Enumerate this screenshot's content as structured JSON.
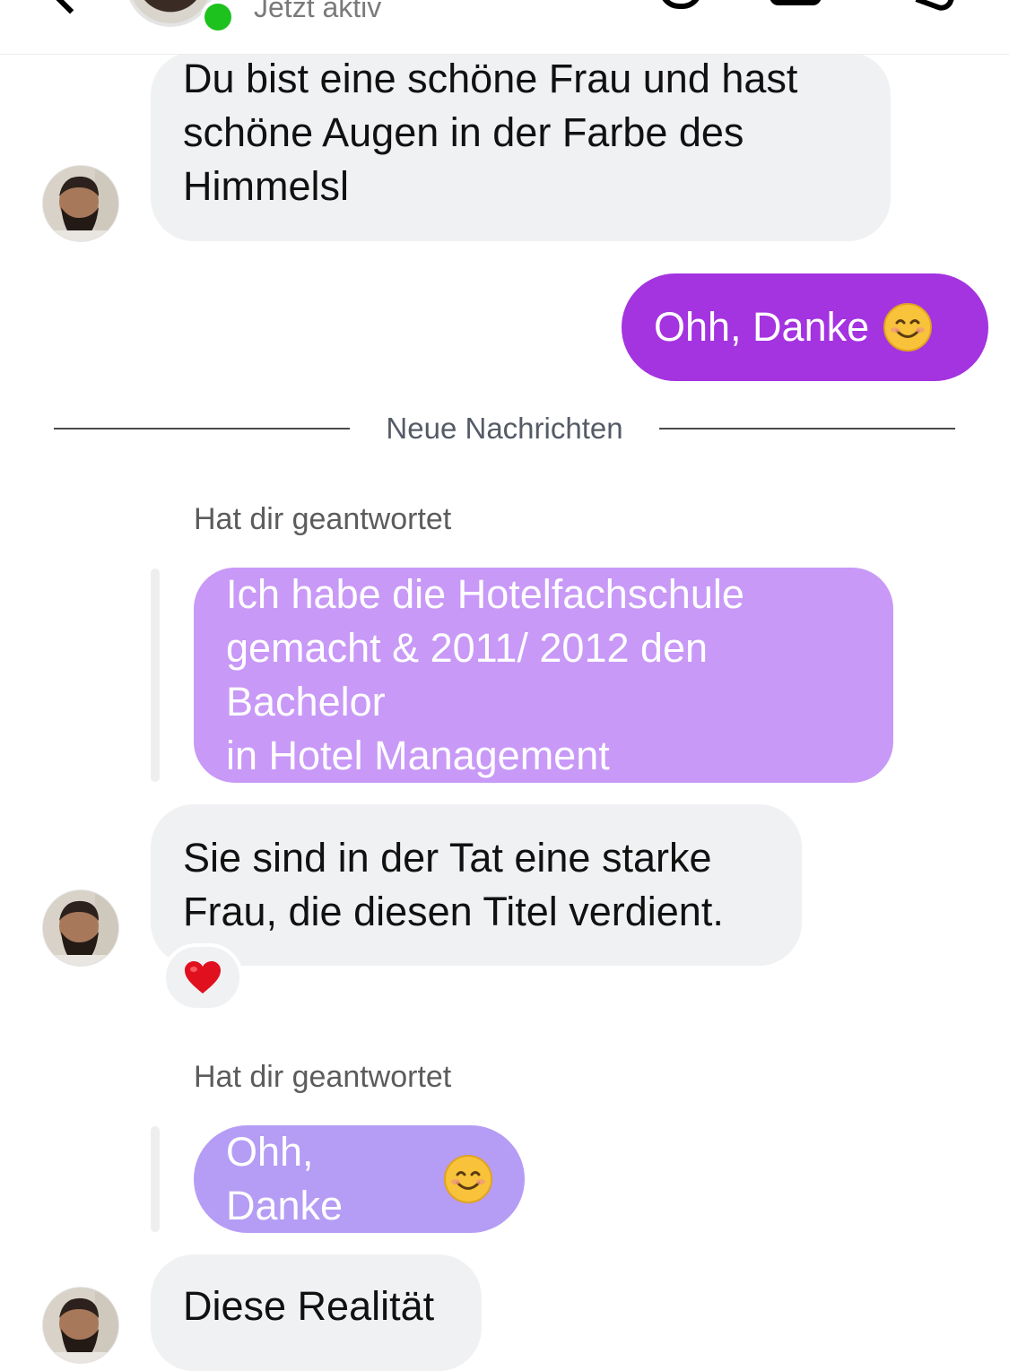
{
  "header": {
    "status": "Jetzt aktiv"
  },
  "messages": {
    "m1": {
      "lines": [
        "Du bist eine schöne Frau und hast",
        "schöne Augen in der Farbe des",
        "Himmelsl"
      ]
    },
    "m2": {
      "text": "Ohh, Danke",
      "emoji": "smiling-face-icon"
    },
    "divider": "Neue Nachrichten",
    "reply1": {
      "label": "Hat dir geantwortet",
      "lines": [
        "Ich habe die Hotelfachschule",
        "gemacht & 2011/ 2012 den Bachelor",
        "in Hotel Management"
      ]
    },
    "m3": {
      "lines": [
        "Sie sind in der Tat eine starke",
        "Frau, die diesen Titel verdient."
      ],
      "reaction": "heart-icon"
    },
    "reply2": {
      "label": "Hat dir geantwortet",
      "text": "Ohh, Danke",
      "emoji": "smiling-face-icon"
    },
    "m4": {
      "text": "Diese Realität"
    }
  },
  "colors": {
    "outgoing_bubble": "#a433e0",
    "reply_bubble": "#c899f7",
    "reply_bubble_light": "#b59cf5",
    "incoming_bubble": "#f0f1f3",
    "online": "#1ec21e"
  }
}
